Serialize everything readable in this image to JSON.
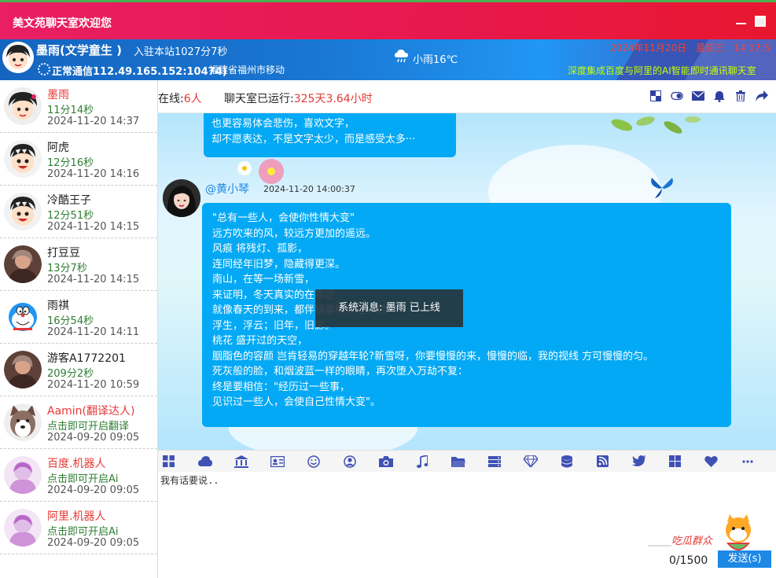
{
  "window": {
    "title": "美文苑聊天室欢迎您"
  },
  "profile": {
    "name": "墨雨(文学童生 )",
    "joined": "入驻本站1027分7秒",
    "connection": "正常通信112.49.165.152:10474)",
    "location": "福建省福州市移动",
    "weather": "小雨16℃",
    "datetime": "2024年11月20日　星期三　14:17:5",
    "marquee": "深度集成百度与阿里的AI智能即时通讯聊天室"
  },
  "sidebar": {
    "users": [
      {
        "name": "墨雨",
        "status": "11分14秒",
        "time": "2024-11-20 14:37",
        "avatar": "cartoon-girl-avatar"
      },
      {
        "name": "阿虎",
        "status": "12分16秒",
        "time": "2024-11-20 14:16",
        "avatar": "cartoon-boy-avatar"
      },
      {
        "name": "冷酷王子",
        "status": "12分51秒",
        "time": "2024-11-20 14:15",
        "avatar": "cartoon-boy-avatar"
      },
      {
        "name": "打豆豆",
        "status": "13分7秒",
        "time": "2024-11-20 14:15",
        "avatar": "photo-avatar"
      },
      {
        "name": "雨祺",
        "status": "16分54秒",
        "time": "2024-11-20 14:11",
        "avatar": "doraemon-avatar"
      },
      {
        "name": "游客A1772201",
        "status": "209分2秒",
        "time": "2024-11-20 10:59",
        "avatar": "photo-avatar"
      },
      {
        "name": "Aamin(翻译达人)",
        "status": "点击即可开启翻译",
        "time": "2024-09-20 09:05",
        "avatar": "husky-avatar"
      },
      {
        "name": "百度.机器人",
        "status": "点击即可开启Ai",
        "time": "2024-09-20 09:05",
        "avatar": "robot-avatar"
      },
      {
        "name": "阿里.机器人",
        "status": "点击即可开启Ai",
        "time": "2024-09-20 09:05",
        "avatar": "robot-avatar"
      }
    ]
  },
  "header": {
    "online_label": "在线:",
    "online_count": "6人",
    "uptime_label": "聊天室已运行:",
    "uptime_value": "325天3.64小时",
    "icons": [
      "layout-icon",
      "toggle-icon",
      "mail-icon",
      "bell-icon",
      "trash-icon",
      "share-icon"
    ]
  },
  "chat": {
    "prev_message": [
      "也更容易体会悲伤，喜欢文字，",
      "却不愿表达，不是文字太少，而是感受太多···"
    ],
    "message": {
      "sender": "@黄小琴",
      "time": "2024-11-20 14:00:37",
      "lines": [
        "\"总有一些人，会使你性情大变\"",
        "远方吹来的风，较远方更加的遥远。",
        "风痕 将残灯、孤影，",
        "连同经年旧梦，隐藏得更深。",
        "南山，在等一场新雪，",
        "来证明，冬天真实的在靠近",
        "就像春天的到来，都伴随着桃花在打更。",
        "浮生，浮云；旧年，旧影。",
        "桃花 盛开过的天空，",
        "胭脂色的容颜 岂肯轻易的穿越年轮?新雪呀，你要慢慢的来，慢慢的临，我的视线 方可慢慢的匀。",
        "死灰般的脸，和烟波蓝一样的眼睛，再次堕入万劫不复：",
        "终是要相信：\"经历过一些事，",
        "见识过一些人，会使自己性情大变\"。"
      ]
    },
    "system_message": "系统消息: 墨雨 已上线"
  },
  "toolbar": {
    "tools": [
      "apps-icon",
      "cloud-icon",
      "bank-icon",
      "id-card-icon",
      "smile-icon",
      "user-circle-icon",
      "camera-icon",
      "music-icon",
      "folder-icon",
      "server-icon",
      "diamond-icon",
      "database-icon",
      "rss-icon",
      "twitter-icon",
      "windows-icon",
      "heart-icon",
      "more-icon"
    ]
  },
  "input": {
    "placeholder": "我有话要说..",
    "counter": "0/1500",
    "send_label": "发送(s)",
    "mascot_text": "吃瓜群众"
  },
  "colors": {
    "accent": "#03a9f4",
    "title_bar": "#e91e63",
    "profile_bar": "#1976d2",
    "highlight": "#e53935",
    "status_green": "#2e7d32"
  }
}
